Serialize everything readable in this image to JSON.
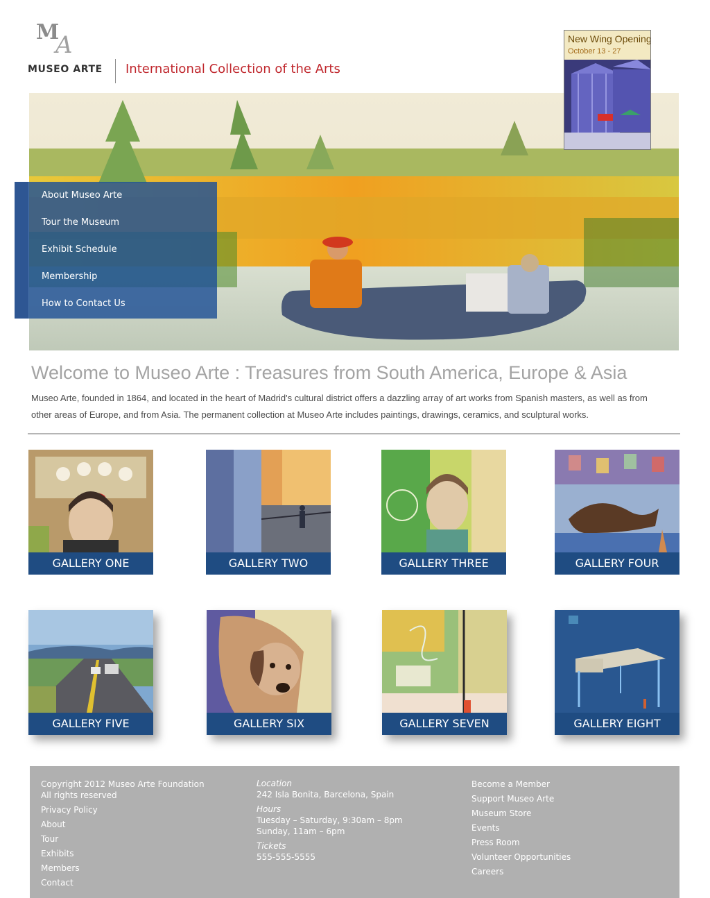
{
  "header": {
    "logo_initials": "MA",
    "logo_text": "MUSEO ARTE",
    "tagline": "International Collection of the Arts"
  },
  "promo": {
    "title": "New Wing Opening",
    "dates": "October 13 - 27"
  },
  "nav": {
    "items": [
      {
        "label": "About Museo Arte"
      },
      {
        "label": "Tour the Museum"
      },
      {
        "label": "Exhibit Schedule"
      },
      {
        "label": "Membership"
      },
      {
        "label": "How to Contact Us"
      }
    ]
  },
  "welcome": {
    "title": "Welcome to Museo Arte : Treasures from South America, Europe & Asia",
    "text": "Museo Arte, founded in 1864, and located in the heart of Madrid's cultural district offers a dazzling array of art works from Spanish masters, as well as from other areas of Europe, and from Asia. The permanent collection at Museo Arte includes paintings, drawings, ceramics, and sculptural works."
  },
  "galleries": [
    {
      "label": "GALLERY ONE"
    },
    {
      "label": "GALLERY TWO"
    },
    {
      "label": "GALLERY THREE"
    },
    {
      "label": "GALLERY FOUR"
    },
    {
      "label": "GALLERY FIVE"
    },
    {
      "label": "GALLERY SIX"
    },
    {
      "label": "GALLERY SEVEN"
    },
    {
      "label": "GALLERY EIGHT"
    }
  ],
  "footer": {
    "copyright": "Copyright 2012 Museo Arte Foundation",
    "rights": "All rights reserved",
    "links_left": [
      "Privacy Policy",
      "About",
      "Tour",
      "Exhibits",
      "Members",
      "Contact"
    ],
    "location_label": "Location",
    "address": "242 Isla Bonita, Barcelona, Spain",
    "hours_label": "Hours",
    "hours_line1": "Tuesday – Saturday, 9:30am – 8pm",
    "hours_line2": "Sunday, 11am – 6pm",
    "tickets_label": "Tickets",
    "phone": "555-555-5555",
    "links_right": [
      "Become a Member",
      "Support Museo Arte",
      "Museum Store",
      "Events",
      "Press Room",
      "Volunteer Opportunities",
      "Careers"
    ]
  },
  "colors": {
    "nav_overlay": "#1e5096",
    "gallery_label_bg": "#1f4c82",
    "tagline": "#c0272d",
    "footer_bg": "#b0b0b0"
  }
}
